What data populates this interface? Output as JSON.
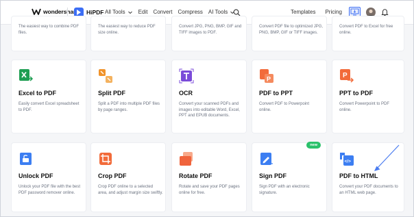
{
  "header": {
    "brand": "wondershare",
    "product": "HiPDF",
    "nav": [
      {
        "label": "All Tools",
        "dropdown": true
      },
      {
        "label": "Edit",
        "dropdown": false
      },
      {
        "label": "Convert",
        "dropdown": false
      },
      {
        "label": "Compress",
        "dropdown": false
      },
      {
        "label": "AI Tools",
        "dropdown": true
      }
    ],
    "right_nav": {
      "templates": "Templates",
      "pricing": "Pricing"
    },
    "accent": "#3c6ef5"
  },
  "top_row": [
    {
      "desc": "The easiest way to combine PDF files."
    },
    {
      "desc": "The easiest way to reduce PDF size online."
    },
    {
      "desc": "Convert JPG, PNG, BMP, GIF and TIFF images to PDF."
    },
    {
      "desc": "Convert PDF file to optimized JPG, PNG, BMP, GIF or TIFF images."
    },
    {
      "desc": "Convert PDF to Excel for free online."
    }
  ],
  "middle_row": [
    {
      "title": "Excel to PDF",
      "desc": "Easily convert Excel spreadsheet to PDF.",
      "icon": "excel-icon",
      "color": "#1e9e52"
    },
    {
      "title": "Split PDF",
      "desc": "Split a PDF into multiple PDF files by page ranges.",
      "icon": "split-icon",
      "color": "#f0932b"
    },
    {
      "title": "OCR",
      "desc": "Convert your scanned PDFs and images into editable Word, Excel, PPT and EPUB documents.",
      "icon": "ocr-icon",
      "color": "#7b4cd9"
    },
    {
      "title": "PDF to PPT",
      "desc": "Convert PDF to Powerpoint online.",
      "icon": "ppt-icon",
      "color": "#f26b3a"
    },
    {
      "title": "PPT to PDF",
      "desc": "Convert Powerpoint to PDF online.",
      "icon": "ppt-icon",
      "color": "#f26b3a"
    }
  ],
  "bottom_row": [
    {
      "title": "Unlock PDF",
      "desc": "Unlock your PDF file with the best PDF password remover online.",
      "icon": "unlock-icon",
      "color": "#3c7ef2"
    },
    {
      "title": "Crop PDF",
      "desc": "Crop PDF online to a selected area, and adjust margin size swiftly.",
      "icon": "crop-icon",
      "color": "#f26b3a"
    },
    {
      "title": "Rotate PDF",
      "desc": "Rotate and save your PDF pages online for free.",
      "icon": "rotate-icon",
      "color": "#f0643c"
    },
    {
      "title": "Sign PDF",
      "desc": "Sign PDF with an electronic signature.",
      "icon": "sign-icon",
      "color": "#3c7ef2",
      "badge": "new"
    },
    {
      "title": "PDF to HTML",
      "desc": "Convert your PDF documents to an HTML web page.",
      "icon": "html-icon",
      "color": "#3c7ef2"
    }
  ]
}
